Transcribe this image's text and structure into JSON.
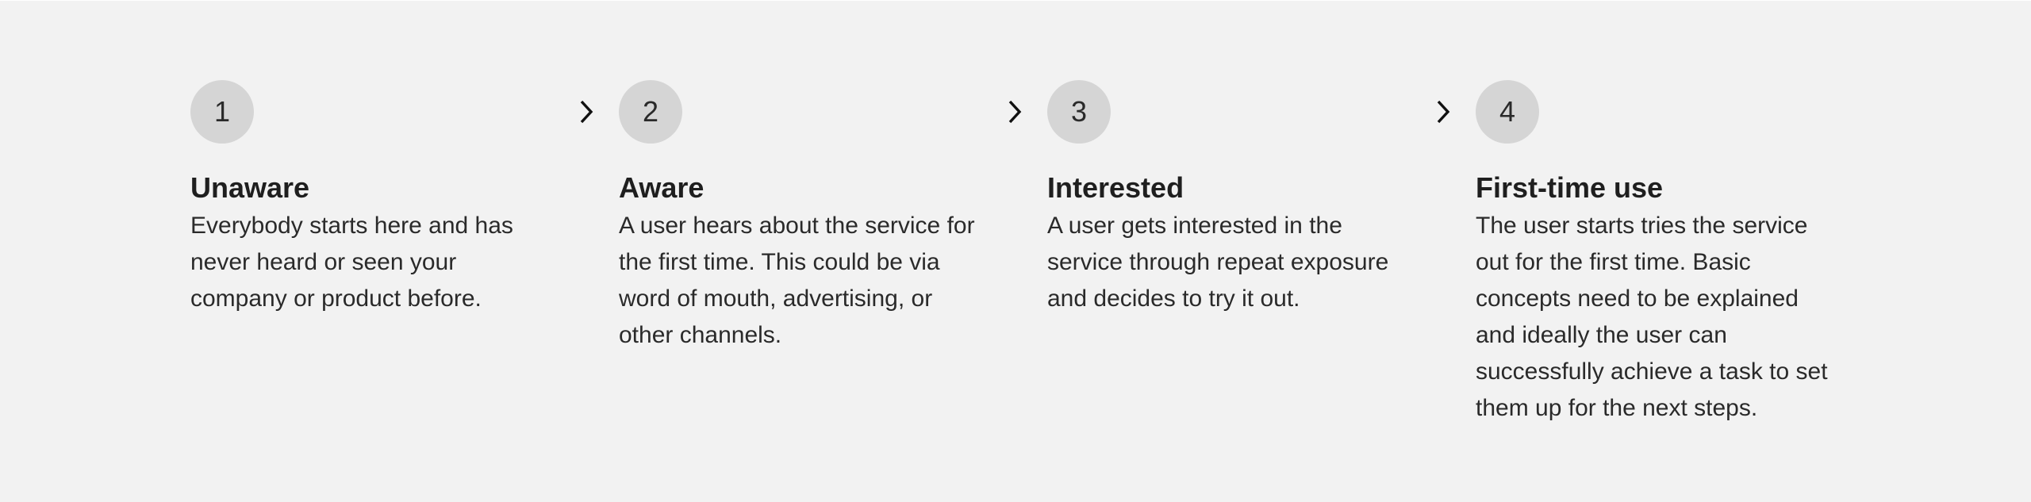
{
  "steps": [
    {
      "number": "1",
      "title": "Unaware",
      "description": "Everybody starts here and has never heard or seen your company or product before."
    },
    {
      "number": "2",
      "title": "Aware",
      "description": "A user hears about the service for the first time. This could be via word of mouth, advertising, or other channels."
    },
    {
      "number": "3",
      "title": "Interested",
      "description": "A user gets interested in the service through repeat exposure and decides to try it out."
    },
    {
      "number": "4",
      "title": "First-time use",
      "description": "The user starts tries the service out for the first time. Basic concepts need to be explained and ideally the user can successfully achieve a task to set them up for the next steps."
    }
  ],
  "connector_icon": "chevron-right-icon",
  "colors": {
    "background": "#f2f2f2",
    "circle": "#d5d5d5",
    "text": "#1f1f1f"
  }
}
